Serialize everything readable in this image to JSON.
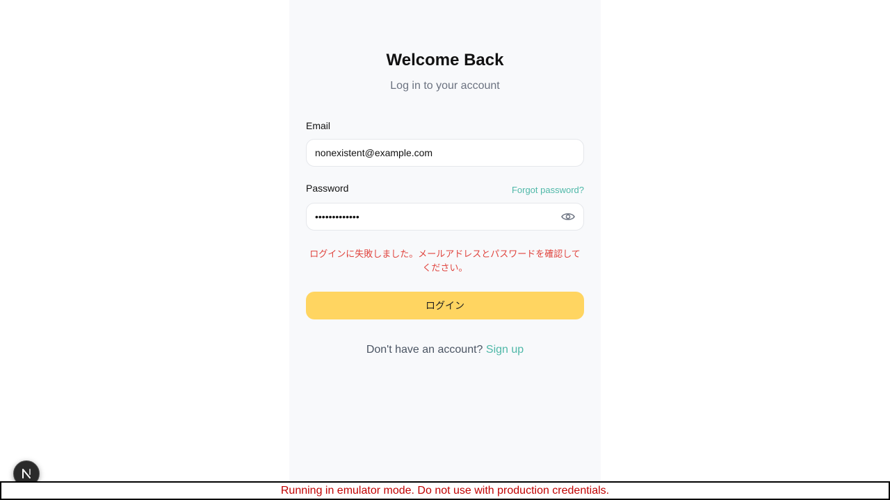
{
  "header": {
    "title": "Welcome Back",
    "subtitle": "Log in to your account"
  },
  "form": {
    "email_label": "Email",
    "email_value": "nonexistent@example.com",
    "password_label": "Password",
    "password_value": "•••••••••••••",
    "forgot_password": "Forgot password?",
    "error_message": "ログインに失敗しました。メールアドレスとパスワードを確認してください。",
    "login_button": "ログイン"
  },
  "footer": {
    "no_account_text": "Don't have an account?",
    "signup_link": "Sign up"
  },
  "banner": {
    "text": "Running in emulator mode. Do not use with production credentials."
  },
  "icons": {
    "password_toggle": "eye-icon",
    "dev_indicator": "next-logo-icon"
  },
  "colors": {
    "accent": "#4fb8a8",
    "button": "#ffd561",
    "error": "#e0443e",
    "banner_text": "#c00000"
  }
}
